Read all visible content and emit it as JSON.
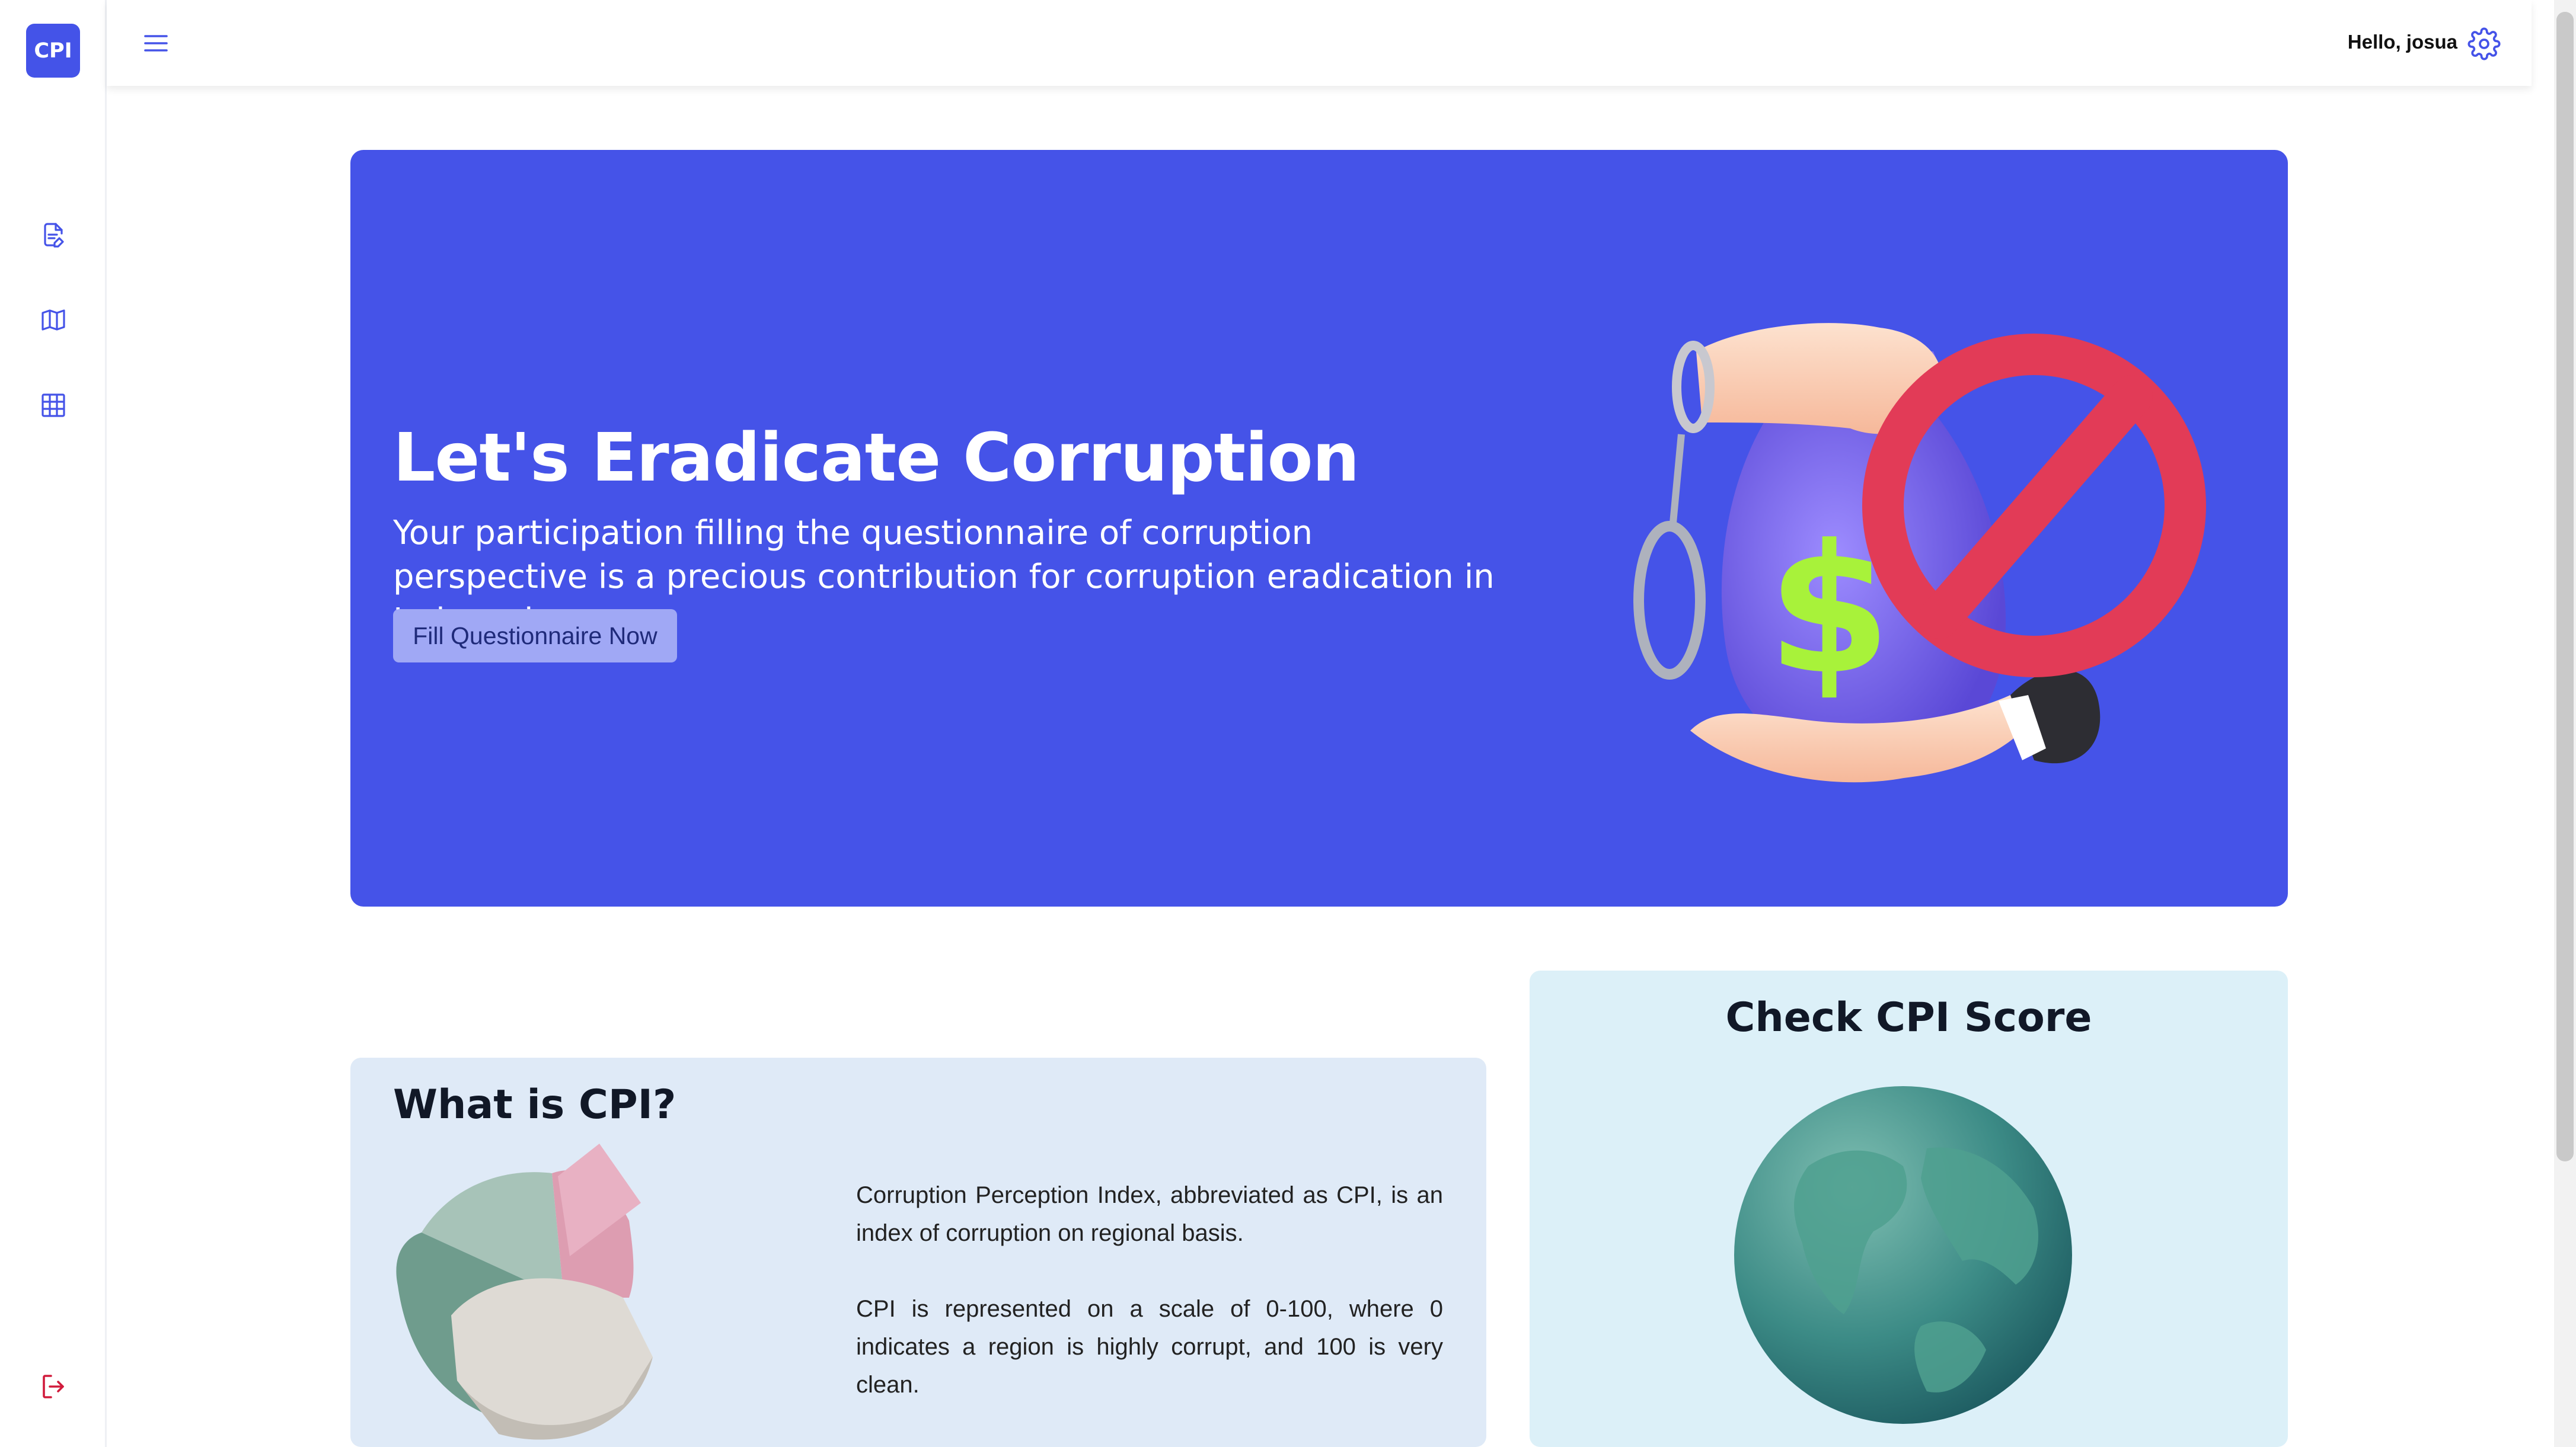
{
  "app": {
    "logo_text": "CPI"
  },
  "sidebar": {
    "items": [
      {
        "icon": "document-edit-icon"
      },
      {
        "icon": "map-icon"
      },
      {
        "icon": "table-grid-icon"
      }
    ],
    "logout_icon": "logout-icon"
  },
  "topbar": {
    "menu_icon": "hamburger-menu-icon",
    "greeting": "Hello, josua",
    "settings_icon": "gear-icon"
  },
  "hero": {
    "title": "Let's Eradicate Corruption",
    "description": "Your participation filling the questionnaire of corruption perspective is a precious contribution for corruption eradication in Indonesia.",
    "button_label": "Fill Questionnaire Now",
    "colors": {
      "background": "#4553e8",
      "button": "#a0a8f5"
    }
  },
  "about": {
    "title": "What is CPI?",
    "paragraph1": "Corruption Perception Index, abbreviated as CPI, is an index of corruption on regional basis.",
    "paragraph2": "CPI is represented on a scale of 0-100, where 0 indicates a region is highly corrupt, and 100 is very clean."
  },
  "score": {
    "title": "Check CPI Score"
  }
}
